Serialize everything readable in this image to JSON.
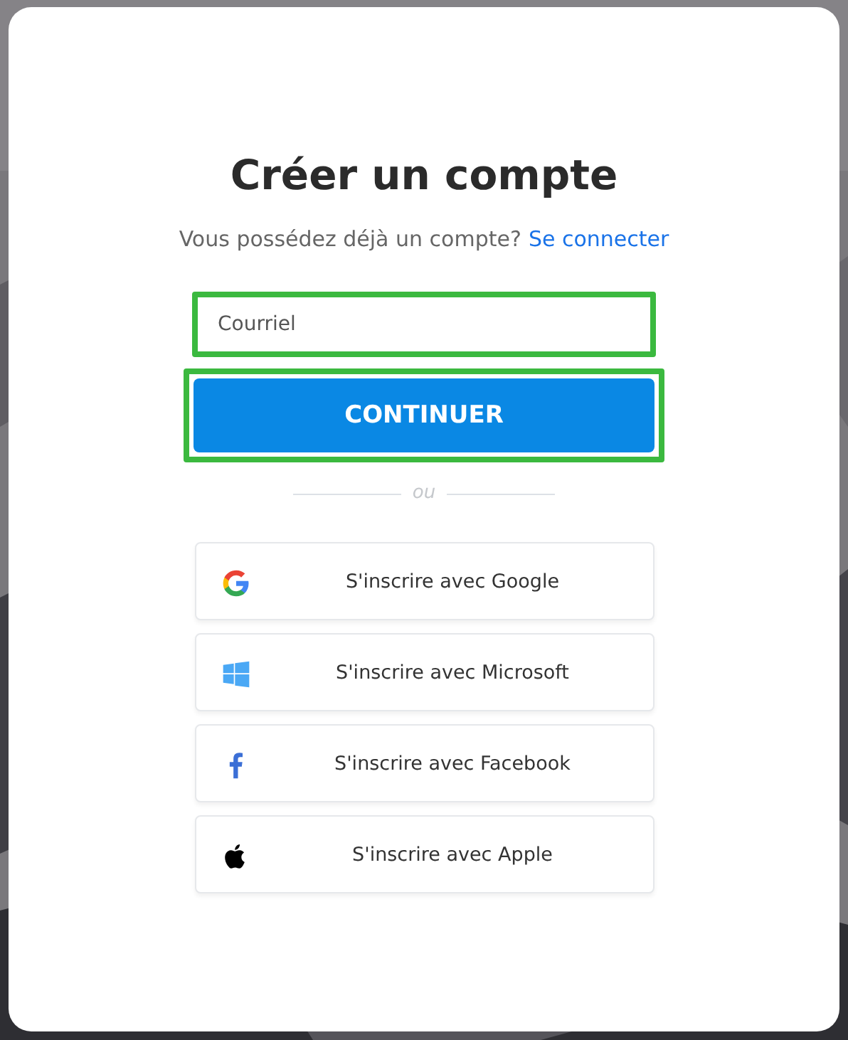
{
  "title": "Créer un compte",
  "subtitle": {
    "text": "Vous possédez déjà un compte?",
    "link": "Se connecter"
  },
  "email_field": {
    "placeholder": "Courriel",
    "highlighted": true
  },
  "continue_button": {
    "label": "CONTINUER",
    "highlighted": true
  },
  "separator": "ou",
  "providers": [
    {
      "kind": "google",
      "label": "S'inscrire avec Google"
    },
    {
      "kind": "microsoft",
      "label": "S'inscrire avec Microsoft"
    },
    {
      "kind": "facebook",
      "label": "S'inscrire avec Facebook"
    },
    {
      "kind": "apple",
      "label": "S'inscrire avec Apple"
    }
  ]
}
